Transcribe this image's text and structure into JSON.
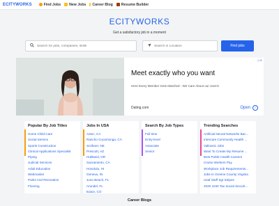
{
  "topbar": {
    "logo": "ECITYWORKS",
    "nav": [
      {
        "label": "Find Jobs",
        "icon": "search-icon"
      },
      {
        "label": "New Jobs",
        "icon": "sparkle-icon"
      },
      {
        "label": "Career Blog",
        "icon": "pencil-icon"
      },
      {
        "label": "Resume Builder",
        "icon": "briefcase-icon"
      }
    ]
  },
  "hero": {
    "brand": "ECITYWORKS",
    "tagline": "Get a satisfactory job in a moment"
  },
  "search": {
    "jobs_placeholder": "Search for jobs, companies, skills",
    "location_placeholder": "Search in Location",
    "button_label": "Find jobs"
  },
  "ad": {
    "headline": "Meet exactly who you want",
    "subtext": "Here Every Member Gets Matched - We Care About our Users!",
    "domain": "Dating.com",
    "cta": "Open",
    "cta_icon": "chevron-right-icon"
  },
  "columns": [
    {
      "title": "Popular By Job Titles",
      "accent": "#f59e0b",
      "items": [
        "Home Child Care",
        "Social Service",
        "Sports Construction",
        "Clinical Applications Specialist",
        "Piping",
        "Judicial Services",
        "Adult Education",
        "Webmaster",
        "Parks And Recreation",
        "Flooring"
      ]
    },
    {
      "title": "Jobs In USA",
      "accent": "#f59e0b",
      "items": [
        "Aztec, CA",
        "Rancho Cucamonga, CA",
        "Scribner, NE",
        "Prescott, AZ",
        "Hubbard, OR",
        "Sacramento, CA",
        "Honolulu, HI",
        "Geneva, IN",
        "Juno Beach, FL",
        "Arundel, FL",
        "Eaton, CO"
      ]
    },
    {
      "title": "Search By Job Types",
      "accent": "#a855f7",
      "items": [
        "Full time",
        "Entry-level",
        "Associate",
        "Senior"
      ]
    },
    {
      "title": "Trending Searches",
      "accent": "#ec4899",
      "items": [
        "Artificial Neural Networks Bac...",
        "Intercare Community Health ...",
        "Valloosic Jobs",
        "Want To Create My Resume ...",
        "Best Public Health Careers",
        "Cruise Workers Pay",
        "Workplace Job Requirements...",
        "Jobs In Greene County Virginia",
        "Usaf Staff Sgt Stripes",
        "2020 1040 Tax Social Securit..."
      ]
    }
  ],
  "footer": {
    "title": "Career Blogs"
  }
}
